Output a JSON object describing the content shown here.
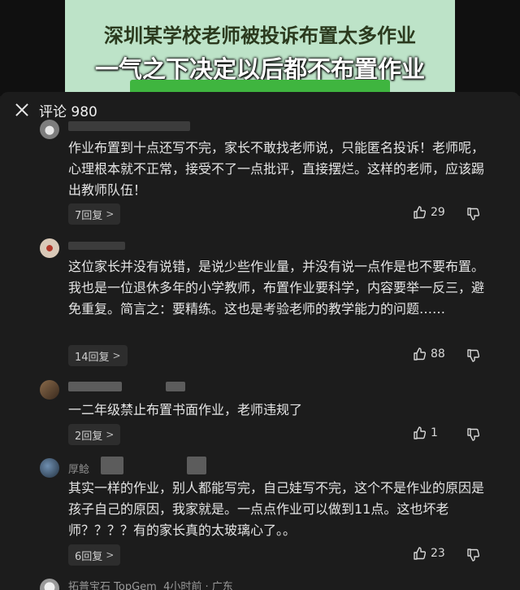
{
  "video": {
    "caption_line1": "深圳某学校老师被投诉布置太多作业",
    "caption_line2": "一气之下决定以后都不布置作业"
  },
  "sheet": {
    "title": "评论 980"
  },
  "comments": [
    {
      "text": "作业布置到十点还写不完，家长不敢找老师说，只能匿名投诉！老师呢，心理根本就不正常，接受不了一点批评，直接摆烂。这样的老师，应该踢出教师队伍！",
      "replies": "7回复",
      "likes": "29"
    },
    {
      "text": "这位家长并没有说错，是说少些作业量，并没有说一点作是也不要布置。我也是一位退休多年的小学教师，布置作业要科学，内容要举一反三，避免重复。简言之：要精练。这也是考验老师的教学能力的问题……",
      "replies": "14回复",
      "likes": "88"
    },
    {
      "text": "一二年级禁止布置书面作业，老师违规了",
      "replies": "2回复",
      "likes": "1"
    },
    {
      "user": "厚鲶",
      "text": "其实一样的作业，别人都能写完，自己娃写不完，这个不是作业的原因是孩子自己的原因，我家就是。一点点作业可以做到11点。这也坏老师？？？？有的家长真的太玻璃心了。。",
      "replies": "6回复",
      "likes": "23"
    },
    {
      "user": "拓普宝石 TopGem",
      "meta": "4小时前 · 广东"
    }
  ],
  "icons": {
    "close": "close-icon",
    "like": "thumbs-up-icon",
    "dislike": "thumbs-down-icon",
    "chevron": "chevron-right-icon"
  },
  "colors": {
    "sheet_bg": "#1c1c1c",
    "text": "#e4e4e4",
    "muted": "#8c8c8c",
    "caption_green": "#bde3c8"
  }
}
